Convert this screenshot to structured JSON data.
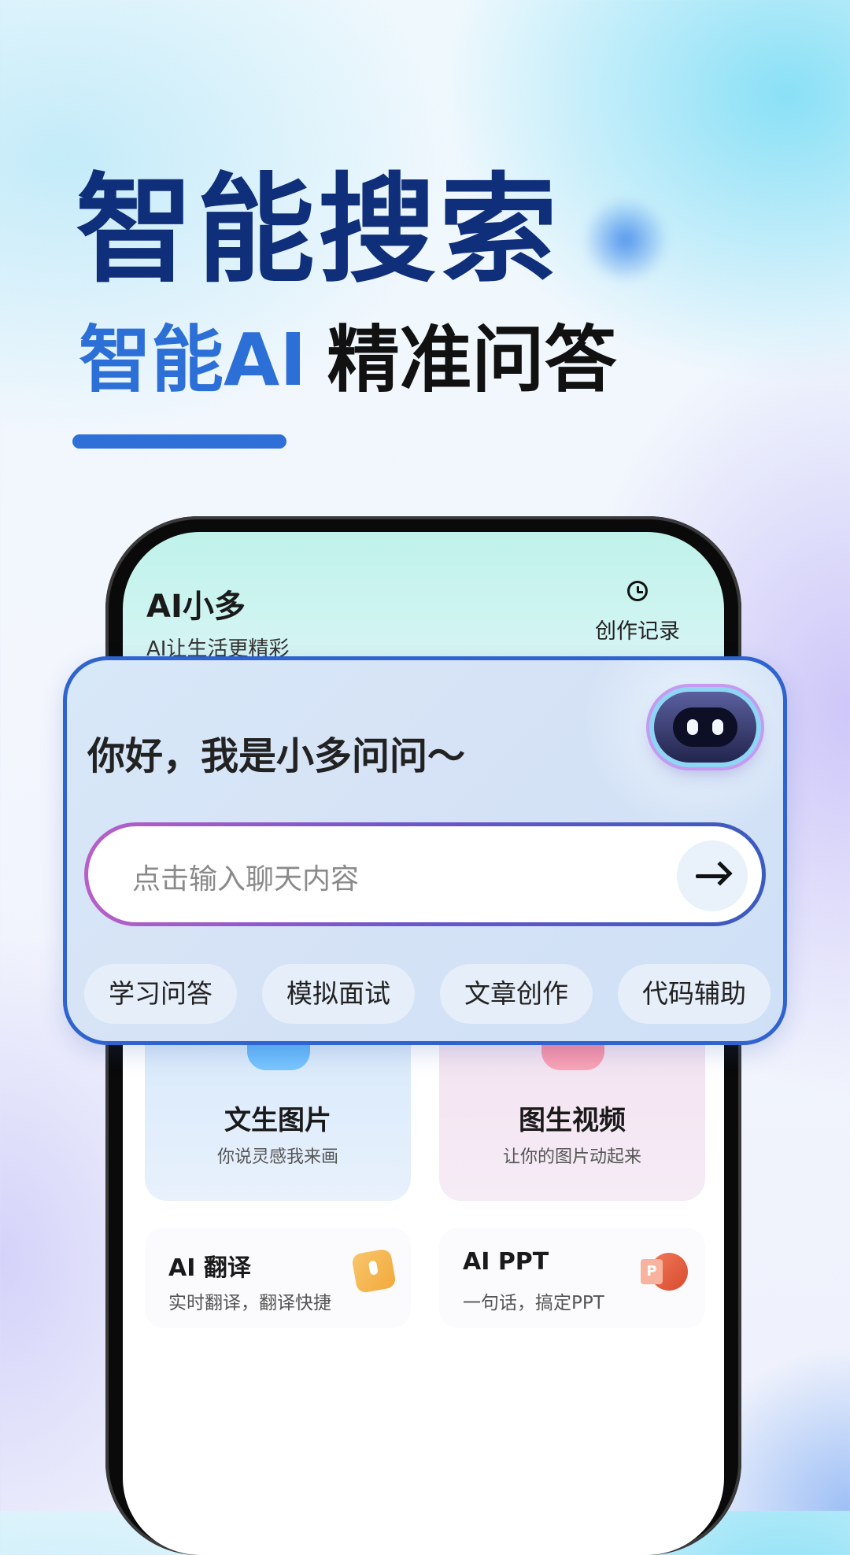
{
  "hero": {
    "title": "智能搜索",
    "subtitle_blue": "智能AI",
    "subtitle_black": "精准问答"
  },
  "app": {
    "name": "AI小多",
    "tagline": "AI让生活更精彩",
    "history_label": "创作记录",
    "history_icon": "clock-icon"
  },
  "chat": {
    "greeting": "你好，我是小多问问～",
    "input_placeholder": "点击输入聊天内容",
    "send_icon": "arrow-right-icon",
    "chips": [
      "学习问答",
      "模拟面试",
      "文章创作",
      "代码辅助"
    ]
  },
  "features": [
    {
      "title": "文生图片",
      "subtitle": "你说灵感我来画",
      "icon": "image-icon"
    },
    {
      "title": "图生视频",
      "subtitle": "让你的图片动起来",
      "icon": "video-icon"
    }
  ],
  "tools": [
    {
      "title": "AI 翻译",
      "subtitle": "实时翻译，翻译快捷",
      "icon": "microphone-icon"
    },
    {
      "title": "AI PPT",
      "subtitle": "一句话，搞定PPT",
      "icon": "ppt-icon"
    }
  ],
  "colors": {
    "title_navy": "#0f2f7a",
    "accent_blue": "#2c6fd6",
    "card_border": "#2f63cf"
  }
}
